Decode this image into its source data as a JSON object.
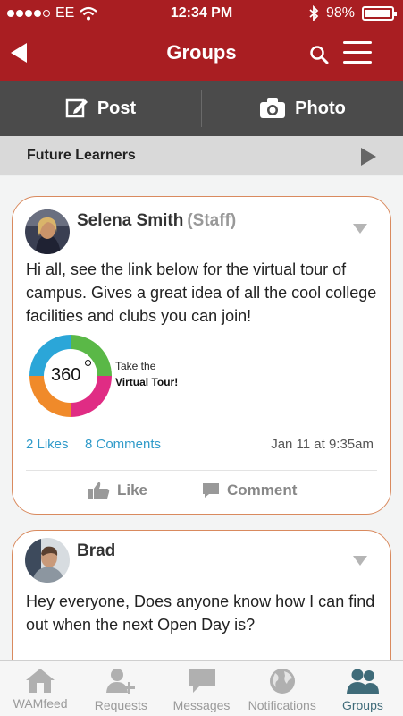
{
  "status": {
    "carrier": "EE",
    "time": "12:34 PM",
    "battery": "98%"
  },
  "nav": {
    "title": "Groups"
  },
  "actions": {
    "post": "Post",
    "photo": "Photo"
  },
  "group": {
    "name": "Future Learners"
  },
  "posts": [
    {
      "author": "Selena Smith",
      "role": "(Staff)",
      "text": "Hi all, see the link below for the virtual tour of campus. Gives a great idea of all the cool college facilities and clubs you can join!",
      "tour": {
        "number": "360",
        "line1": "Take the",
        "line2": "Virtual Tour!"
      },
      "likes": "2 Likes",
      "comments": "8 Comments",
      "date": "Jan 11 at 9:35am",
      "like_label": "Like",
      "comment_label": "Comment"
    },
    {
      "author": "Brad",
      "text": "Hey everyone, Does anyone know how I can find out when the next Open Day is?"
    }
  ],
  "tabs": [
    {
      "label": "WAMfeed",
      "icon": "home-icon"
    },
    {
      "label": "Requests",
      "icon": "add-person-icon"
    },
    {
      "label": "Messages",
      "icon": "speech-bubble-icon"
    },
    {
      "label": "Notifications",
      "icon": "globe-icon"
    },
    {
      "label": "Groups",
      "icon": "group-icon",
      "active": true
    }
  ],
  "colors": {
    "brand": "#a91e22",
    "link": "#2f9ac9",
    "active_tab": "#3f6b79"
  }
}
